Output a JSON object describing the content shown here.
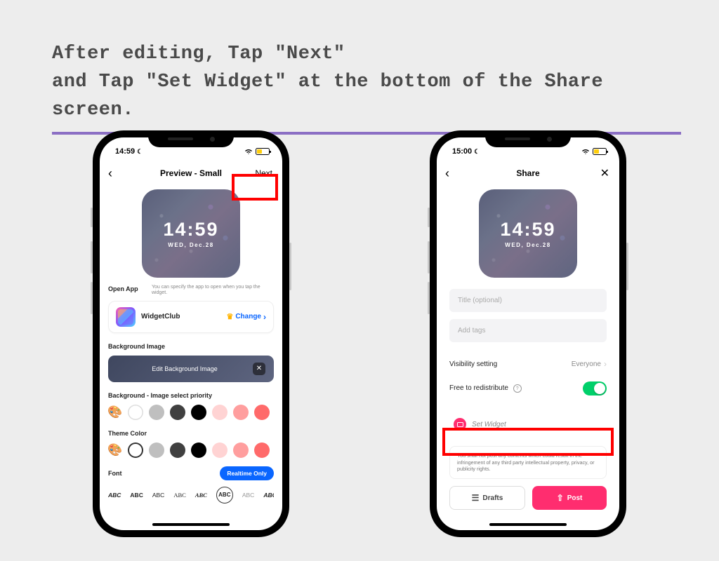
{
  "heading": {
    "line1": "After editing, Tap \"Next\"",
    "line2": "and Tap \"Set Widget\" at the bottom of the Share screen."
  },
  "phone1": {
    "status_time": "14:59",
    "nav_title": "Preview - Small",
    "nav_next": "Next",
    "widget": {
      "time": "14:59",
      "date": "WED, Dec.28"
    },
    "open_app": {
      "label": "Open App",
      "sub": "You can specify the app to open when you tap the widget.",
      "app_name": "WidgetClub",
      "change": "Change"
    },
    "bg_image": {
      "label": "Background Image",
      "edit": "Edit Background Image"
    },
    "bg_priority_label": "Background - Image select priority",
    "theme_color_label": "Theme Color",
    "font_label": "Font",
    "realtime_btn": "Realtime Only",
    "font_options": [
      "ABC",
      "ABC",
      "ABC",
      "ABC",
      "ABC",
      "ABC",
      "ABC",
      "ABC"
    ],
    "swatch_colors_bg": [
      "#ffffff",
      "#bfbfbf",
      "#404040",
      "#000000",
      "#ffd3d3",
      "#ff9e9e",
      "#ff6a6a"
    ],
    "swatch_colors_theme": [
      "#ffffff",
      "#bfbfbf",
      "#404040",
      "#000000",
      "#ffd3d3",
      "#ff9e9e",
      "#ff6a6a"
    ]
  },
  "phone2": {
    "status_time": "15:00",
    "nav_title": "Share",
    "widget": {
      "time": "14:59",
      "date": "WED, Dec.28"
    },
    "title_placeholder": "Title (optional)",
    "tags_placeholder": "Add tags",
    "visibility": {
      "label": "Visibility setting",
      "value": "Everyone"
    },
    "redistribute_label": "Free to redistribute",
    "set_widget": "Set Widget",
    "legal": "You shall not post any contents which could result in the infringement of any third party intellectual property, privacy, or publicity rights.",
    "drafts_btn": "Drafts",
    "post_btn": "Post"
  }
}
